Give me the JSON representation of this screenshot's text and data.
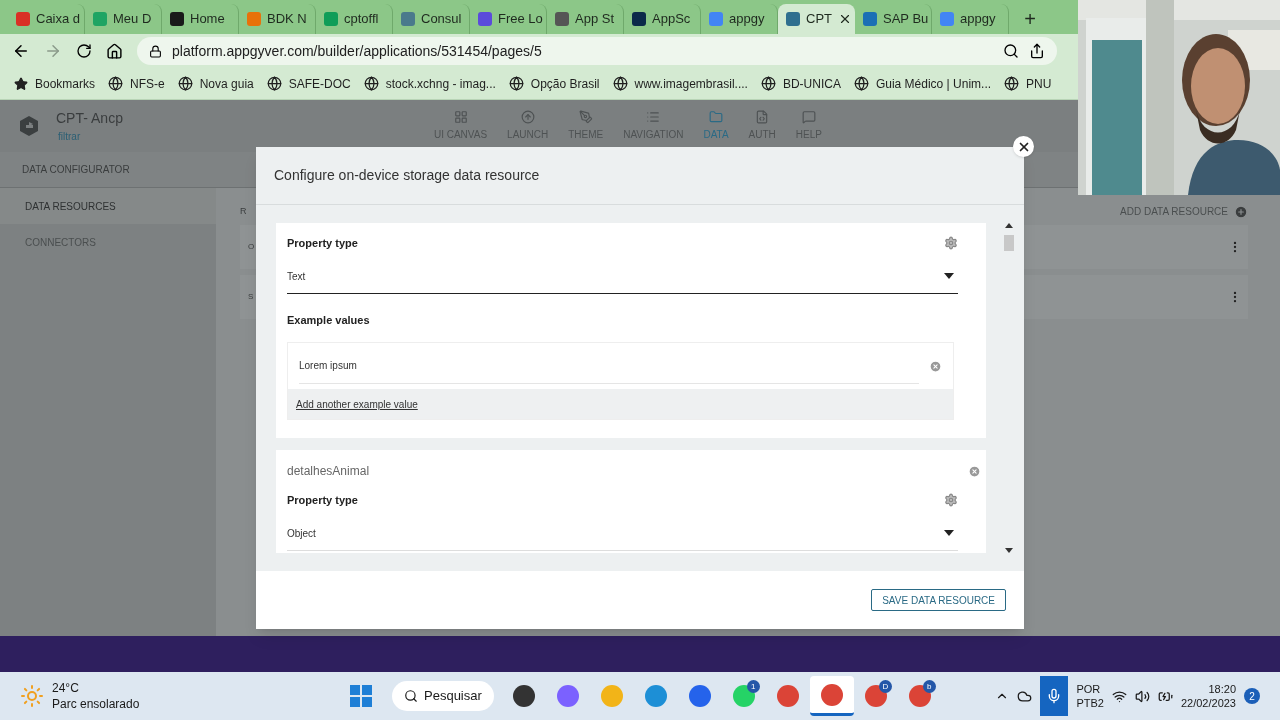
{
  "browser": {
    "tabs": [
      {
        "label": "Caixa d",
        "selected": false,
        "color": "#d93025"
      },
      {
        "label": "Meu D",
        "selected": false,
        "color": "#1fa463"
      },
      {
        "label": "Home",
        "selected": false,
        "color": "#1a1a1a"
      },
      {
        "label": "BDK N",
        "selected": false,
        "color": "#e8710a"
      },
      {
        "label": "cptoffl",
        "selected": false,
        "color": "#0f9d58"
      },
      {
        "label": "Consul",
        "selected": false,
        "color": "#4a7a8c"
      },
      {
        "label": "Free Lo",
        "selected": false,
        "color": "#5b4bdb"
      },
      {
        "label": "App St",
        "selected": false,
        "color": "#555555"
      },
      {
        "label": "AppSc",
        "selected": false,
        "color": "#0b2a4a"
      },
      {
        "label": "appgy",
        "selected": false,
        "color": "#4285f4"
      },
      {
        "label": "CPT",
        "selected": true,
        "color": "#2f6f8f"
      },
      {
        "label": "SAP Bu",
        "selected": false,
        "color": "#1b6fb5"
      },
      {
        "label": "appgy",
        "selected": false,
        "color": "#4285f4"
      }
    ],
    "new_tab": "+",
    "address": "platform.appgyver.com/builder/applications/531454/pages/5",
    "bookmarks": [
      "Bookmarks",
      "NFS-e",
      "Nova guia",
      "SAFE-DOC",
      "stock.xchng - imag...",
      "Opção Brasil",
      "www.imagembrasil....",
      "BD-UNICA",
      "Guia Médico | Unim...",
      "PNU"
    ]
  },
  "app": {
    "title": "CPT- Ancp",
    "breadcrumb": "filtrar",
    "nav": [
      {
        "label": "UI CANVAS",
        "selected": false,
        "kind": "canvas"
      },
      {
        "label": "LAUNCH",
        "selected": false,
        "kind": "launch"
      },
      {
        "label": "THEME",
        "selected": false,
        "kind": "theme"
      },
      {
        "label": "NAVIGATION",
        "selected": false,
        "kind": "navigation"
      },
      {
        "label": "DATA",
        "selected": true,
        "kind": "data"
      },
      {
        "label": "AUTH",
        "selected": false,
        "kind": "auth"
      },
      {
        "label": "HELP",
        "selected": false,
        "kind": "help"
      }
    ],
    "section": "DATA CONFIGURATOR",
    "sidebar": [
      {
        "label": "DATA RESOURCES",
        "selected": true
      },
      {
        "label": "CONNECTORS",
        "selected": false
      }
    ],
    "column_1": "R",
    "add_button": "ADD DATA RESOURCE",
    "rows": [
      "O",
      "S"
    ]
  },
  "modal": {
    "title": "Configure on-device storage data resource",
    "properties": [
      {
        "property_type_label": "Property type",
        "type": "Text",
        "example_values_label": "Example values",
        "examples": [
          "Lorem ipsum"
        ],
        "add_link": "Add another example value"
      },
      {
        "name": "detalhesAnimal",
        "property_type_label": "Property type",
        "type": "Object"
      }
    ],
    "save_button": "SAVE DATA RESOURCE"
  },
  "taskbar": {
    "temperature": "24°C",
    "condition": "Parc ensolarado",
    "search": "Pesquisar",
    "apps": [
      {
        "kind": "taskview",
        "selected": false
      },
      {
        "kind": "chat",
        "selected": false
      },
      {
        "kind": "explorer",
        "selected": false
      },
      {
        "kind": "edge",
        "selected": false
      },
      {
        "kind": "store",
        "selected": false
      },
      {
        "kind": "whatsapp",
        "badge": "1",
        "selected": false
      },
      {
        "kind": "chrome",
        "selected": false
      },
      {
        "kind": "chrome",
        "selected": true
      },
      {
        "kind": "chrome",
        "badge": "D",
        "selected": false
      },
      {
        "kind": "chrome",
        "badge": "b",
        "selected": false
      }
    ],
    "language": "POR",
    "layout": "PTB2",
    "time": "18:20",
    "date": "22/02/2023",
    "notifications": "2"
  }
}
